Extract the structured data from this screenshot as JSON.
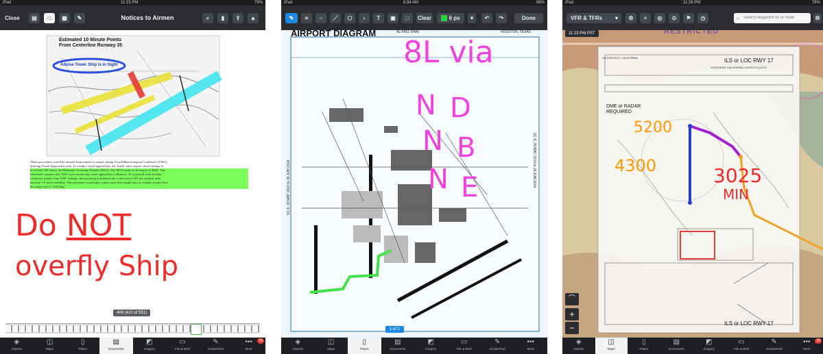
{
  "colors": {
    "toolbar": "#2b2d31",
    "tabbar": "#1d1f22",
    "accent_blue": "#1e88e5",
    "highlight_pink": "#ee44dd",
    "ink_red": "#ef2a2a",
    "ink_orange": "#ff9800",
    "badge_red": "#e53935",
    "highlight_green": "#7cff5a"
  },
  "tabs": [
    {
      "label": "Airports",
      "icon": "airport-icon"
    },
    {
      "label": "Maps",
      "icon": "map-icon"
    },
    {
      "label": "Plates",
      "icon": "plate-icon"
    },
    {
      "label": "Documents",
      "icon": "documents-icon"
    },
    {
      "label": "Imagery",
      "icon": "imagery-icon"
    },
    {
      "label": "File & Brief",
      "icon": "file-brief-icon"
    },
    {
      "label": "ScratchPad",
      "icon": "scratchpad-icon"
    },
    {
      "label": "More",
      "icon": "more-icon"
    }
  ],
  "panel1": {
    "status": {
      "carrier": "iPad",
      "time": "11:15 PM",
      "battery": "78%"
    },
    "toolbar": {
      "close_label": "Close",
      "title": "Notices to Airmen"
    },
    "figure": {
      "title_line1": "Estimated 10 Minute Points",
      "title_line2": "From Centerline Runway 35",
      "callout": "Advise Tower Ship is in Sight"
    },
    "body_text": [
      "These procedures would be utilized from sunrise to sunset, during Visual Meteorological Conditions (VMC),",
      "utilizing Visual Approaches only. To conduct visual approaches, Air Traffic rules require cloud ceilings to"
    ],
    "highlighted_text": [
      "be at least 500' above the Minimum Vectoring Altitude (MVA). The MVA south of the airport is 2600'. This",
      "effectively requires that 2500' from conducting visual approaches to Runway 35 to periods with weather",
      "conditions greater than 3100' ceilings, and assuming a standard rate of descent of 319' per nautical mile,",
      "between 5-6 miles visibility. This procedure would give a pilot more than ample time to visually acquire both",
      "the airport and a \"Tall Ship\""
    ],
    "handwriting": {
      "line1_part1": "Do",
      "line1_part2": "NOT",
      "line2": "overfly Ship"
    },
    "page_indicator": "408 (410 of 551)",
    "badge": "29",
    "active_tab": 3
  },
  "panel2": {
    "status": {
      "carrier": "iPad",
      "time": "8:34 AM",
      "battery": "86%"
    },
    "toolbar": {
      "clear_label": "Clear",
      "pen_size": "6 px",
      "done_label": "Done"
    },
    "header": {
      "left": "AIRPORT DIAGRAM",
      "center": "AL-5451 (FAA)",
      "right": "HOUSTON, TEXAS"
    },
    "handwriting": {
      "line1": "8L via",
      "letters": [
        "N",
        "D",
        "N",
        "B",
        "N",
        "E"
      ]
    },
    "side_text": "SC-5, 28 MAY 2014 to 26 JUN 2014",
    "page_indicator": "1 of 1",
    "active_tab": 2
  },
  "panel3": {
    "status": {
      "carrier": "iPad",
      "time": "11:26 PM",
      "battery": "78%"
    },
    "toolbar": {
      "layer_label": "VFR & TFRs",
      "search_placeholder": "Search waypoint ID or route"
    },
    "clock": "11:23 PM PST",
    "map_label": "RESTRICTED",
    "plate": {
      "title": "ILS or LOC RWY 17",
      "subtitle": "SOUTHERN CALIFORNIA LOGISTICS (VCV)",
      "location": "VICTORVILLE, CALIFORNIA",
      "dme_note": "DME or RADAR REQUIRED",
      "bottom_title": "ILS or LOC RWY 17"
    },
    "handwriting": {
      "alt1": "5200",
      "alt2": "4300",
      "alt3": "3025",
      "note": "MIN"
    },
    "badge": "29",
    "active_tab": 1
  }
}
